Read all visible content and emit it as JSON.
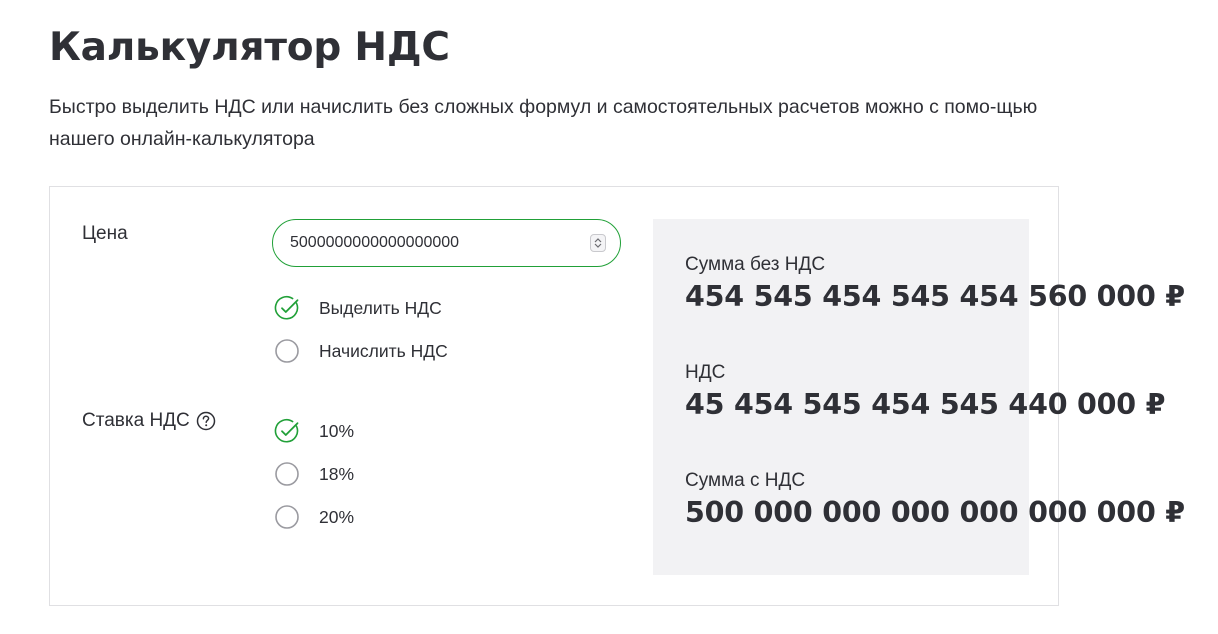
{
  "header": {
    "title": "Калькулятор НДС",
    "subtitle": "Быстро выделить НДС или начислить без сложных формул и самостоятельных расчетов можно с помо-щью нашего онлайн-калькулятора"
  },
  "form": {
    "price_label": "Цена",
    "price_value": "5000000000000000000",
    "mode_options": [
      {
        "label": "Выделить НДС",
        "selected": true
      },
      {
        "label": "Начислить НДС",
        "selected": false
      }
    ],
    "rate_label": "Ставка НДС",
    "rate_help_icon": "question-circle-icon",
    "rate_options": [
      {
        "label": "10%",
        "selected": true
      },
      {
        "label": "18%",
        "selected": false
      },
      {
        "label": "20%",
        "selected": false
      }
    ]
  },
  "results": {
    "without_vat_label": "Сумма без НДС",
    "without_vat_value": "454 545 454 545 454 560 000 ₽",
    "vat_label": "НДС",
    "vat_value": "45 454 545 454 545 440 000 ₽",
    "with_vat_label": "Сумма с НДС",
    "with_vat_value": "500 000 000 000 000 000 000 ₽"
  },
  "colors": {
    "accent": "#21a038",
    "text": "#2f3036",
    "panel_bg": "#f2f2f4",
    "border": "#e0e0e3",
    "radio_border": "#9a9aa0"
  }
}
